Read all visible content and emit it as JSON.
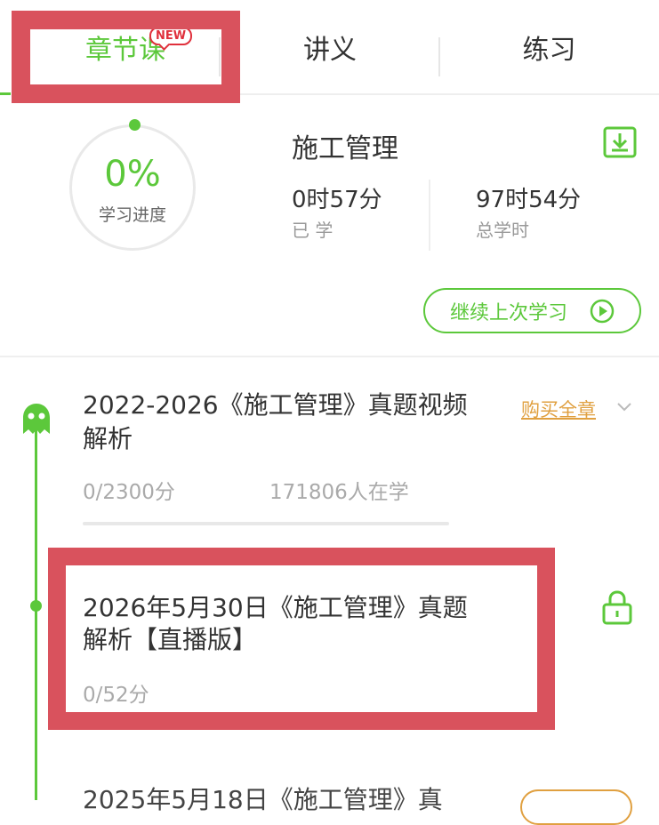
{
  "tabs": {
    "chapter": "章节课",
    "new_badge": "NEW",
    "lecture": "讲义",
    "practice": "练习"
  },
  "course": {
    "title": "施工管理",
    "progress_value": "0%",
    "progress_label": "学习进度",
    "progress_fraction": 0,
    "learned_value": "0时57分",
    "learned_label": "已 学",
    "total_value": "97时54分",
    "total_label": "总学时",
    "continue_label": "继续上次学习"
  },
  "chapter": {
    "title": "2022-2026《施工管理》真题视频解析",
    "buy_label": "购买全章",
    "score": "0/2300分",
    "learners": "171806人在学",
    "progress_fraction": 0
  },
  "lesson": {
    "title": "2026年5月30日《施工管理》真题解析【直播版】",
    "score": "0/52分"
  },
  "next_lesson": {
    "title": "2025年5月18日《施工管理》真"
  },
  "colors": {
    "accent": "#5cc83b",
    "highlight": "#d9525d",
    "buy": "#e0a040",
    "badge": "#e0303c"
  },
  "icons": {
    "download": "download-icon",
    "play": "play-circle-icon",
    "ghost": "ghost-icon",
    "lock": "lock-icon",
    "chevron": "chevron-down-icon"
  }
}
